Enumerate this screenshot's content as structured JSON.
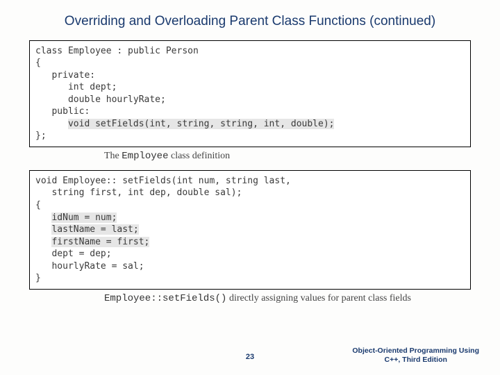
{
  "title": "Overriding and Overloading Parent Class Functions (continued)",
  "code1": {
    "l1": "class Employee : public Person",
    "l2": "{",
    "l3": "   private:",
    "l4": "      int dept;",
    "l5": "      double hourlyRate;",
    "l6": "   public:",
    "l7_pre": "      ",
    "l7_hl": "void setFields(int, string, string, int, double);",
    "l8": "};"
  },
  "caption1": {
    "pre": "The ",
    "mono": "Employee",
    "post": " class definition"
  },
  "code2": {
    "l1": "void Employee:: setFields(int num, string last,",
    "l2": "   string first, int dep, double sal);",
    "l3": "{",
    "l4_pre": "   ",
    "l4_hl": "idNum = num;",
    "l5_pre": "   ",
    "l5_hl": "lastName = last;",
    "l6_pre": "   ",
    "l6_hl": "firstName = first;",
    "l7": "   dept = dep;",
    "l8": "   hourlyRate = sal;",
    "l9": "}"
  },
  "caption2": {
    "mono": "Employee::setFields()",
    "post": " directly assigning values for parent class fields"
  },
  "page_number": "23",
  "book_line1": "Object-Oriented Programming Using",
  "book_line2": "C++, Third Edition"
}
